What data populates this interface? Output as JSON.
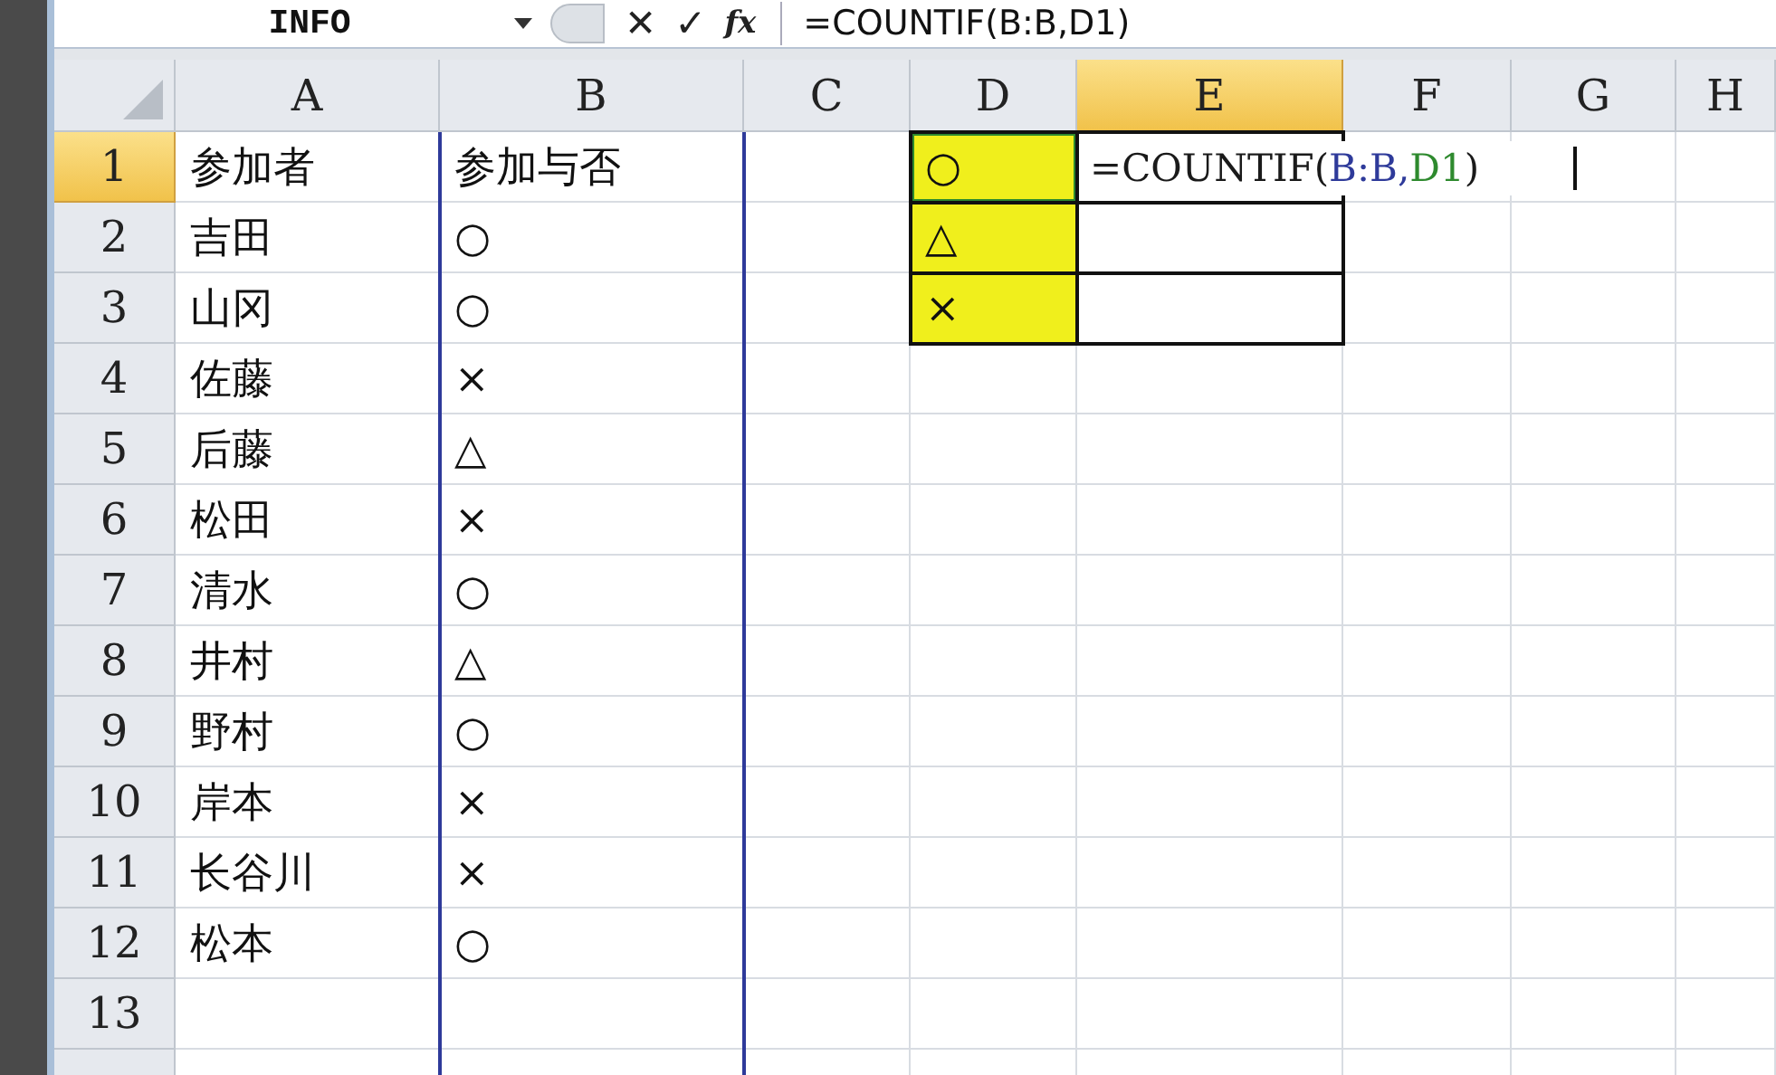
{
  "formula_bar": {
    "name_box": "INFO",
    "cancel": "✕",
    "enter": "✓",
    "fx": "fx",
    "formula": "=COUNTIF(B:B,D1)"
  },
  "sheet": {
    "columns": [
      {
        "label": "A",
        "selected": false,
        "referenced": false
      },
      {
        "label": "B",
        "selected": false,
        "referenced": true
      },
      {
        "label": "C",
        "selected": false,
        "referenced": false
      },
      {
        "label": "D",
        "selected": false,
        "referenced": false
      },
      {
        "label": "E",
        "selected": true,
        "referenced": false
      },
      {
        "label": "F",
        "selected": false,
        "referenced": false
      },
      {
        "label": "G",
        "selected": false,
        "referenced": false
      },
      {
        "label": "H",
        "selected": false,
        "referenced": false
      }
    ],
    "rows": [
      {
        "label": "1",
        "selected": true,
        "cells": {
          "a": {
            "text": "参加者"
          },
          "b": {
            "text": "参加与否"
          },
          "d": {
            "text": "○",
            "highlighted": true,
            "referenced": true,
            "boxed": true
          },
          "e": {
            "boxed": true,
            "editing": true,
            "parts": [
              {
                "text": "=COUNTIF(",
                "color": "#1a1a1a"
              },
              {
                "text": "B:B,",
                "color": "#2e3a9a"
              },
              {
                "text": "D1",
                "color": "#2e8a2e"
              },
              {
                "text": ")",
                "color": "#1a1a1a"
              }
            ]
          }
        }
      },
      {
        "label": "2",
        "selected": false,
        "cells": {
          "a": {
            "text": "吉田"
          },
          "b": {
            "text": "○"
          },
          "d": {
            "text": "△",
            "highlighted": true,
            "boxed": true
          },
          "e": {
            "boxed": true
          }
        }
      },
      {
        "label": "3",
        "selected": false,
        "cells": {
          "a": {
            "text": "山冈"
          },
          "b": {
            "text": "○"
          },
          "d": {
            "text": "×",
            "highlighted": true,
            "boxed": true
          },
          "e": {
            "boxed": true
          }
        }
      },
      {
        "label": "4",
        "selected": false,
        "cells": {
          "a": {
            "text": "佐藤"
          },
          "b": {
            "text": "×"
          }
        }
      },
      {
        "label": "5",
        "selected": false,
        "cells": {
          "a": {
            "text": "后藤"
          },
          "b": {
            "text": "△"
          }
        }
      },
      {
        "label": "6",
        "selected": false,
        "cells": {
          "a": {
            "text": "松田"
          },
          "b": {
            "text": "×"
          }
        }
      },
      {
        "label": "7",
        "selected": false,
        "cells": {
          "a": {
            "text": "清水"
          },
          "b": {
            "text": "○"
          }
        }
      },
      {
        "label": "8",
        "selected": false,
        "cells": {
          "a": {
            "text": "井村"
          },
          "b": {
            "text": "△"
          }
        }
      },
      {
        "label": "9",
        "selected": false,
        "cells": {
          "a": {
            "text": "野村"
          },
          "b": {
            "text": "○"
          }
        }
      },
      {
        "label": "10",
        "selected": false,
        "cells": {
          "a": {
            "text": "岸本"
          },
          "b": {
            "text": "×"
          }
        }
      },
      {
        "label": "11",
        "selected": false,
        "cells": {
          "a": {
            "text": "长谷川"
          },
          "b": {
            "text": "×"
          }
        }
      },
      {
        "label": "12",
        "selected": false,
        "cells": {
          "a": {
            "text": "松本"
          },
          "b": {
            "text": "○"
          }
        }
      },
      {
        "label": "13",
        "selected": false,
        "cells": {}
      }
    ]
  }
}
